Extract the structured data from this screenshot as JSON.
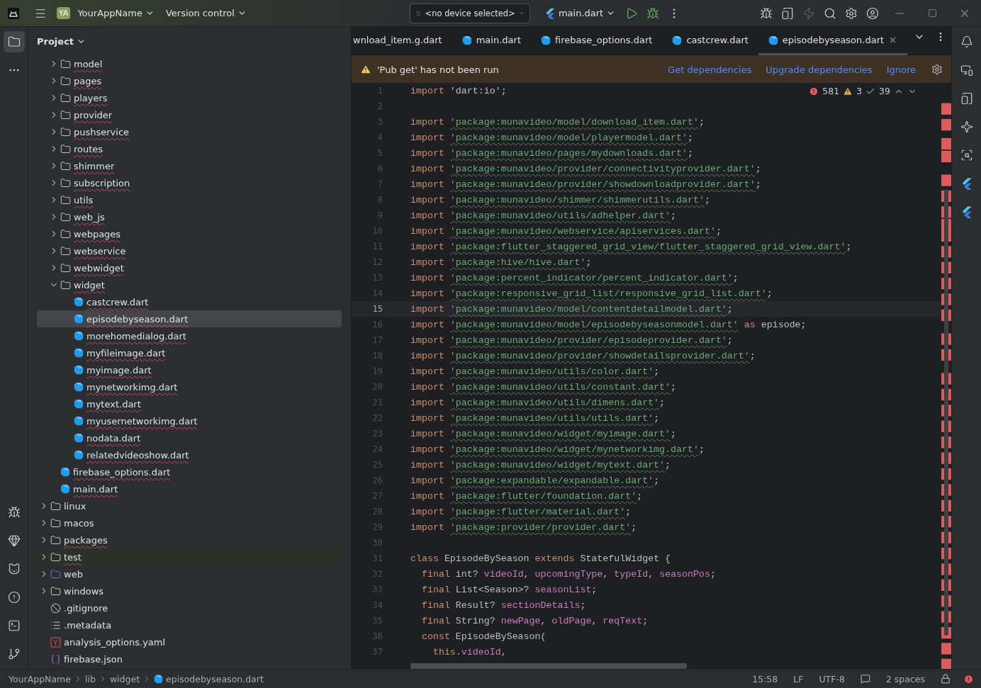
{
  "title_bar": {
    "project_badge": "YA",
    "project": "YourAppName",
    "vcs": "Version control",
    "device": "<no device selected>",
    "run_config": "main.dart"
  },
  "project_panel": {
    "title": "Project",
    "tree": [
      {
        "kind": "offscreen-parent",
        "children": [
          {
            "kind": "folder",
            "label": "model",
            "expanded": false,
            "error": true,
            "selected": false
          },
          {
            "kind": "folder",
            "label": "pages",
            "expanded": false,
            "error": true,
            "selected": false
          },
          {
            "kind": "folder",
            "label": "players",
            "expanded": false,
            "error": true,
            "selected": false
          },
          {
            "kind": "folder",
            "label": "provider",
            "expanded": false,
            "error": true,
            "selected": false
          },
          {
            "kind": "folder",
            "label": "pushservice",
            "expanded": false,
            "error": true,
            "selected": false
          },
          {
            "kind": "folder",
            "label": "routes",
            "expanded": false,
            "error": true,
            "selected": false
          },
          {
            "kind": "folder",
            "label": "shimmer",
            "expanded": false,
            "error": true,
            "selected": false
          },
          {
            "kind": "folder",
            "label": "subscription",
            "expanded": false,
            "error": true,
            "selected": false
          },
          {
            "kind": "folder",
            "label": "utils",
            "expanded": false,
            "error": true,
            "selected": false
          },
          {
            "kind": "folder",
            "label": "web_js",
            "expanded": false,
            "error": true,
            "selected": false
          },
          {
            "kind": "folder",
            "label": "webpages",
            "expanded": false,
            "error": true,
            "selected": false
          },
          {
            "kind": "folder",
            "label": "webservice",
            "expanded": false,
            "error": true,
            "selected": false
          },
          {
            "kind": "folder",
            "label": "webwidget",
            "expanded": false,
            "error": true,
            "selected": false
          },
          {
            "kind": "folder",
            "label": "widget",
            "expanded": true,
            "error": true,
            "selected": false,
            "children": [
              {
                "kind": "dart",
                "label": "castcrew.dart",
                "error": true,
                "selected": false
              },
              {
                "kind": "dart",
                "label": "episodebyseason.dart",
                "error": true,
                "selected": true
              },
              {
                "kind": "dart",
                "label": "morehomedialog.dart",
                "error": true,
                "selected": false
              },
              {
                "kind": "dart",
                "label": "myfileimage.dart",
                "error": true,
                "selected": false
              },
              {
                "kind": "dart",
                "label": "myimage.dart",
                "error": true,
                "selected": false
              },
              {
                "kind": "dart",
                "label": "mynetworkimg.dart",
                "error": true,
                "selected": false
              },
              {
                "kind": "dart",
                "label": "mytext.dart",
                "error": true,
                "selected": false
              },
              {
                "kind": "dart",
                "label": "myusernetworkimg.dart",
                "error": true,
                "selected": false
              },
              {
                "kind": "dart",
                "label": "nodata.dart",
                "error": true,
                "selected": false
              },
              {
                "kind": "dart",
                "label": "relatedvideoshow.dart",
                "error": true,
                "selected": false
              }
            ]
          },
          {
            "kind": "dart",
            "label": "firebase_options.dart",
            "error": true,
            "selected": false
          },
          {
            "kind": "dart",
            "label": "main.dart",
            "error": true,
            "selected": false
          }
        ]
      },
      {
        "kind": "folder",
        "label": "linux",
        "expanded": false,
        "error": false,
        "selected": false
      },
      {
        "kind": "folder",
        "label": "macos",
        "expanded": false,
        "error": false,
        "selected": false
      },
      {
        "kind": "folder",
        "label": "packages",
        "expanded": false,
        "error": true,
        "selected": false
      },
      {
        "kind": "test-folder",
        "label": "test",
        "expanded": false,
        "error": true,
        "selected": false
      },
      {
        "kind": "web-folder",
        "label": "web",
        "expanded": false,
        "error": false,
        "selected": false
      },
      {
        "kind": "folder",
        "label": "windows",
        "expanded": false,
        "error": false,
        "selected": false
      },
      {
        "kind": "ignore",
        "label": ".gitignore",
        "error": false,
        "selected": false
      },
      {
        "kind": "text",
        "label": ".metadata",
        "error": false,
        "selected": false
      },
      {
        "kind": "yaml",
        "label": "analysis_options.yaml",
        "error": false,
        "selected": false
      },
      {
        "kind": "json",
        "label": "firebase.json",
        "error": false,
        "selected": false
      }
    ]
  },
  "editor": {
    "tabs": [
      {
        "label": "wnload_item.g.dart",
        "selected": false,
        "icon": false
      },
      {
        "label": "main.dart",
        "selected": false,
        "icon": true
      },
      {
        "label": "firebase_options.dart",
        "selected": false,
        "icon": true
      },
      {
        "label": "castcrew.dart",
        "selected": false,
        "icon": true
      },
      {
        "label": "episodebyseason.dart",
        "selected": true,
        "icon": true
      }
    ],
    "banner": {
      "message": "'Pub get' has not been run",
      "actions": [
        "Get dependencies",
        "Upgrade dependencies",
        "Ignore"
      ]
    },
    "inspections": {
      "errors": "581",
      "warnings": "3",
      "typos": "39"
    },
    "lines": [
      {
        "n": "1",
        "current": false,
        "t": [
          {
            "kind": "keyword",
            "text": "import "
          },
          {
            "kind": "plain",
            "text": "'dart:io';"
          }
        ]
      },
      {
        "n": "2",
        "current": false
      },
      {
        "n": "3",
        "current": false,
        "t": [
          {
            "kind": "keyword",
            "text": "import "
          },
          {
            "kind": "string",
            "text": "'package:munavideo/model/download_item.dart'"
          },
          {
            "kind": "plain",
            "text": ";"
          }
        ]
      },
      {
        "n": "4",
        "current": false,
        "t": [
          {
            "kind": "keyword",
            "text": "import "
          },
          {
            "kind": "string",
            "text": "'package:munavideo/model/playermodel.dart'"
          },
          {
            "kind": "plain",
            "text": ";"
          }
        ]
      },
      {
        "n": "5",
        "current": false,
        "t": [
          {
            "kind": "keyword",
            "text": "import "
          },
          {
            "kind": "string",
            "text": "'package:munavideo/pages/mydownloads.dart'"
          },
          {
            "kind": "plain",
            "text": ";"
          }
        ]
      },
      {
        "n": "6",
        "current": false,
        "t": [
          {
            "kind": "keyword",
            "text": "import "
          },
          {
            "kind": "string",
            "text": "'package:munavideo/provider/connectivityprovider.dart'"
          },
          {
            "kind": "plain",
            "text": ";"
          }
        ]
      },
      {
        "n": "7",
        "current": false,
        "t": [
          {
            "kind": "keyword",
            "text": "import "
          },
          {
            "kind": "string",
            "text": "'package:munavideo/provider/showdownloadprovider.dart'"
          },
          {
            "kind": "plain",
            "text": ";"
          }
        ]
      },
      {
        "n": "8",
        "current": false,
        "t": [
          {
            "kind": "keyword",
            "text": "import "
          },
          {
            "kind": "string",
            "text": "'package:munavideo/shimmer/shimmerutils.dart'"
          },
          {
            "kind": "plain",
            "text": ";"
          }
        ]
      },
      {
        "n": "9",
        "current": false,
        "t": [
          {
            "kind": "keyword",
            "text": "import "
          },
          {
            "kind": "string",
            "text": "'package:munavideo/utils/adhelper.dart'"
          },
          {
            "kind": "plain",
            "text": ";"
          }
        ]
      },
      {
        "n": "10",
        "current": false,
        "t": [
          {
            "kind": "keyword",
            "text": "import "
          },
          {
            "kind": "string",
            "text": "'package:munavideo/webservice/apiservices.dart'"
          },
          {
            "kind": "plain",
            "text": ";"
          }
        ]
      },
      {
        "n": "11",
        "current": false,
        "t": [
          {
            "kind": "keyword",
            "text": "import "
          },
          {
            "kind": "string",
            "text": "'package:flutter_staggered_grid_view/flutter_staggered_grid_view.dart'"
          },
          {
            "kind": "plain",
            "text": ";"
          }
        ]
      },
      {
        "n": "12",
        "current": false,
        "t": [
          {
            "kind": "keyword",
            "text": "import "
          },
          {
            "kind": "string",
            "text": "'package:hive/hive.dart'"
          },
          {
            "kind": "plain",
            "text": ";"
          }
        ]
      },
      {
        "n": "13",
        "current": false,
        "t": [
          {
            "kind": "keyword",
            "text": "import "
          },
          {
            "kind": "string",
            "text": "'package:percent_indicator/percent_indicator.dart'"
          },
          {
            "kind": "plain",
            "text": ";"
          }
        ]
      },
      {
        "n": "14",
        "current": false,
        "t": [
          {
            "kind": "keyword",
            "text": "import "
          },
          {
            "kind": "string",
            "text": "'package:responsive_grid_list/responsive_grid_list.dart'"
          },
          {
            "kind": "plain",
            "text": ";"
          }
        ]
      },
      {
        "n": "15",
        "current": true,
        "t": [
          {
            "kind": "keyword",
            "text": "import "
          },
          {
            "kind": "string",
            "text": "'package:munavideo/model/contentdetailmodel.dart'"
          },
          {
            "kind": "plain",
            "text": ";"
          }
        ]
      },
      {
        "n": "16",
        "current": false,
        "t": [
          {
            "kind": "keyword",
            "text": "import "
          },
          {
            "kind": "string",
            "text": "'package:munavideo/model/episodebyseasonmodel.dart'"
          },
          {
            "kind": "keyword",
            "text": " as"
          },
          {
            "kind": "plain",
            "text": " episode;"
          }
        ]
      },
      {
        "n": "17",
        "current": false,
        "t": [
          {
            "kind": "keyword",
            "text": "import "
          },
          {
            "kind": "string",
            "text": "'package:munavideo/provider/episodeprovider.dart'"
          },
          {
            "kind": "plain",
            "text": ";"
          }
        ]
      },
      {
        "n": "18",
        "current": false,
        "t": [
          {
            "kind": "keyword",
            "text": "import "
          },
          {
            "kind": "string",
            "text": "'package:munavideo/provider/showdetailsprovider.dart'"
          },
          {
            "kind": "plain",
            "text": ";"
          }
        ]
      },
      {
        "n": "19",
        "current": false,
        "t": [
          {
            "kind": "keyword",
            "text": "import "
          },
          {
            "kind": "string",
            "text": "'package:munavideo/utils/color.dart'"
          },
          {
            "kind": "plain",
            "text": ";"
          }
        ]
      },
      {
        "n": "20",
        "current": false,
        "t": [
          {
            "kind": "keyword",
            "text": "import "
          },
          {
            "kind": "string",
            "text": "'package:munavideo/utils/constant.dart'"
          },
          {
            "kind": "plain",
            "text": ";"
          }
        ]
      },
      {
        "n": "21",
        "current": false,
        "t": [
          {
            "kind": "keyword",
            "text": "import "
          },
          {
            "kind": "string",
            "text": "'package:munavideo/utils/dimens.dart'"
          },
          {
            "kind": "plain",
            "text": ";"
          }
        ]
      },
      {
        "n": "22",
        "current": false,
        "t": [
          {
            "kind": "keyword",
            "text": "import "
          },
          {
            "kind": "string",
            "text": "'package:munavideo/utils/utils.dart'"
          },
          {
            "kind": "plain",
            "text": ";"
          }
        ]
      },
      {
        "n": "23",
        "current": false,
        "t": [
          {
            "kind": "keyword",
            "text": "import "
          },
          {
            "kind": "string",
            "text": "'package:munavideo/widget/myimage.dart'"
          },
          {
            "kind": "plain",
            "text": ";"
          }
        ]
      },
      {
        "n": "24",
        "current": false,
        "t": [
          {
            "kind": "keyword",
            "text": "import "
          },
          {
            "kind": "string",
            "text": "'package:munavideo/widget/mynetworkimg.dart'"
          },
          {
            "kind": "plain",
            "text": ";"
          }
        ]
      },
      {
        "n": "25",
        "current": false,
        "t": [
          {
            "kind": "keyword",
            "text": "import "
          },
          {
            "kind": "string",
            "text": "'package:munavideo/widget/mytext.dart'"
          },
          {
            "kind": "plain",
            "text": ";"
          }
        ]
      },
      {
        "n": "26",
        "current": false,
        "t": [
          {
            "kind": "keyword",
            "text": "import "
          },
          {
            "kind": "string",
            "text": "'package:expandable/expandable.dart'"
          },
          {
            "kind": "plain",
            "text": ";"
          }
        ]
      },
      {
        "n": "27",
        "current": false,
        "t": [
          {
            "kind": "keyword",
            "text": "import "
          },
          {
            "kind": "string",
            "text": "'package:flutter/foundation.dart'"
          },
          {
            "kind": "plain",
            "text": ";"
          }
        ]
      },
      {
        "n": "28",
        "current": false,
        "t": [
          {
            "kind": "keyword",
            "text": "import "
          },
          {
            "kind": "string",
            "text": "'package:flutter/material.dart'"
          },
          {
            "kind": "plain",
            "text": ";"
          }
        ]
      },
      {
        "n": "29",
        "current": false,
        "t": [
          {
            "kind": "keyword",
            "text": "import "
          },
          {
            "kind": "string",
            "text": "'package:provider/provider.dart'"
          },
          {
            "kind": "plain",
            "text": ";"
          }
        ]
      },
      {
        "n": "30",
        "current": false
      },
      {
        "n": "31",
        "current": false,
        "t": [
          {
            "kind": "keyword",
            "text": "class"
          },
          {
            "kind": "plain",
            "text": " EpisodeBySeason "
          },
          {
            "kind": "keyword",
            "text": "extends"
          },
          {
            "kind": "plain",
            "text": " StatefulWidget {"
          }
        ]
      },
      {
        "n": "32",
        "current": false,
        "t": [
          {
            "kind": "keyword",
            "text": "  final"
          },
          {
            "kind": "plain",
            "text": " int? "
          },
          {
            "kind": "field",
            "text": "videoId"
          },
          {
            "kind": "plain",
            "text": ", "
          },
          {
            "kind": "field",
            "text": "upcomingType"
          },
          {
            "kind": "plain",
            "text": ", "
          },
          {
            "kind": "field",
            "text": "typeId"
          },
          {
            "kind": "plain",
            "text": ", "
          },
          {
            "kind": "field",
            "text": "seasonPos"
          },
          {
            "kind": "plain",
            "text": ";"
          }
        ]
      },
      {
        "n": "33",
        "current": false,
        "t": [
          {
            "kind": "keyword",
            "text": "  final"
          },
          {
            "kind": "plain",
            "text": " List<Season>? "
          },
          {
            "kind": "field",
            "text": "seasonList"
          },
          {
            "kind": "plain",
            "text": ";"
          }
        ]
      },
      {
        "n": "34",
        "current": false,
        "t": [
          {
            "kind": "keyword",
            "text": "  final"
          },
          {
            "kind": "plain",
            "text": " Result? "
          },
          {
            "kind": "field",
            "text": "sectionDetails"
          },
          {
            "kind": "plain",
            "text": ";"
          }
        ]
      },
      {
        "n": "35",
        "current": false,
        "t": [
          {
            "kind": "keyword",
            "text": "  final"
          },
          {
            "kind": "plain",
            "text": " String? "
          },
          {
            "kind": "field",
            "text": "newPage"
          },
          {
            "kind": "plain",
            "text": ", "
          },
          {
            "kind": "field",
            "text": "oldPage"
          },
          {
            "kind": "plain",
            "text": ", "
          },
          {
            "kind": "field",
            "text": "reqText"
          },
          {
            "kind": "plain",
            "text": ";"
          }
        ]
      },
      {
        "n": "36",
        "current": false,
        "t": [
          {
            "kind": "keyword",
            "text": "  const"
          },
          {
            "kind": "plain",
            "text": " EpisodeBySeason("
          }
        ]
      },
      {
        "n": "37",
        "current": false,
        "t": [
          {
            "kind": "keyword",
            "text": "    this"
          },
          {
            "kind": "plain",
            "text": "."
          },
          {
            "kind": "field",
            "text": "videoId"
          },
          {
            "kind": "plain",
            "text": ","
          }
        ]
      }
    ]
  },
  "status_bar": {
    "breadcrumbs": [
      "YourAppName",
      "lib",
      "widget",
      "episodebyseason.dart"
    ],
    "position": "15:58",
    "line_separator": "LF",
    "encoding": "UTF-8",
    "indent": "2 spaces"
  }
}
